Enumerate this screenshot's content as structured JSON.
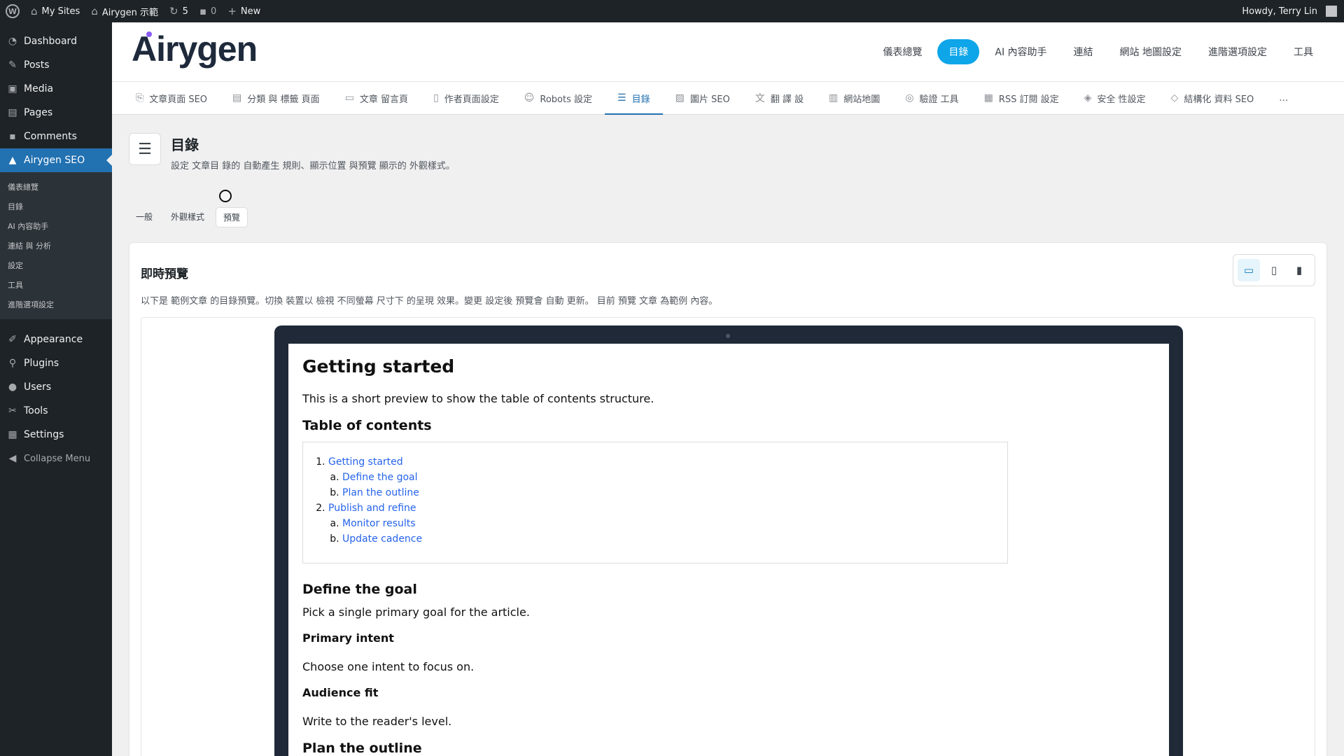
{
  "adminbar": {
    "my_sites": "My Sites",
    "site_name": "Airygen 示範",
    "updates_count": "5",
    "comments_count": "0",
    "new_label": "New",
    "howdy": "Howdy, Terry Lin"
  },
  "menu": {
    "items_top": [
      {
        "label": "Dashboard",
        "icon": "dashboard-icon"
      },
      {
        "label": "Posts",
        "icon": "pin-icon"
      },
      {
        "label": "Media",
        "icon": "media-icon"
      },
      {
        "label": "Pages",
        "icon": "pages-icon"
      },
      {
        "label": "Comments",
        "icon": "comments-icon"
      }
    ],
    "current": {
      "label": "Airygen SEO",
      "icon": "airygen-icon"
    },
    "sub": [
      "儀表總覽",
      "目錄",
      "AI 內容助手",
      "連結 與 分析",
      "設定",
      "工具",
      "進階選項設定"
    ],
    "items_bottom": [
      {
        "label": "Appearance",
        "icon": "brush-icon"
      },
      {
        "label": "Plugins",
        "icon": "plugin-icon"
      },
      {
        "label": "Users",
        "icon": "users-icon"
      },
      {
        "label": "Tools",
        "icon": "wrench-icon"
      },
      {
        "label": "Settings",
        "icon": "settings-icon"
      }
    ],
    "collapse": "Collapse Menu"
  },
  "header": {
    "logo": "irygen",
    "logo_a": "A",
    "nav": [
      "儀表總覽",
      "目錄",
      "AI 內容助手",
      "連結",
      "網站 地圖設定",
      "進階選項設定",
      "工具"
    ],
    "active_index": 1
  },
  "tabs": [
    {
      "label": "文章頁面 SEO",
      "icon": "copy-icon"
    },
    {
      "label": "分類 與 標籤 頁面",
      "icon": "newspaper-icon"
    },
    {
      "label": "文章 留言頁",
      "icon": "comment-icon"
    },
    {
      "label": "作者頁面設定",
      "icon": "file-icon"
    },
    {
      "label": "Robots 設定",
      "icon": "robot-icon"
    },
    {
      "label": "目錄",
      "icon": "list-icon",
      "active": true
    },
    {
      "label": "圖片 SEO",
      "icon": "image-icon"
    },
    {
      "label": "翻 譯 設",
      "icon": "translate-icon"
    },
    {
      "label": "網站地圖",
      "icon": "map-icon"
    },
    {
      "label": "驗證 工具",
      "icon": "check-circle-icon"
    },
    {
      "label": "RSS 訂閱 設定",
      "icon": "rss-icon"
    },
    {
      "label": "安全 性設定",
      "icon": "shield-icon"
    },
    {
      "label": "結構化 資料 SEO",
      "icon": "shield-check-icon"
    },
    {
      "label": "…",
      "icon": ""
    }
  ],
  "page": {
    "title": "目錄",
    "description": "設定 文章目 錄的 自動產生 規則、顯示位置 與預覽 顯示的 外觀樣式。"
  },
  "subtabs": [
    "一般",
    "外觀樣式",
    "預覽"
  ],
  "preview_card": {
    "title": "即時預覽",
    "description": "以下是 範例文章 的目錄預覽。切換 裝置以 檢視 不同螢幕 尺寸下 的呈現 效果。變更 設定後 預覽會 自動 更新。 目前 預覽 文章 為範例 內容。",
    "devices": [
      "laptop-icon",
      "tablet-icon",
      "phone-icon"
    ]
  },
  "article": {
    "h1": "Getting started",
    "intro": "This is a short preview to show the table of contents structure.",
    "toc_title": "Table of contents",
    "toc": [
      {
        "label": "Getting started",
        "children": [
          "Define the goal",
          "Plan the outline"
        ]
      },
      {
        "label": "Publish and refine",
        "children": [
          "Monitor results",
          "Update cadence"
        ]
      }
    ],
    "sec1_title": "Define the goal",
    "sec1_text": "Pick a single primary goal for the article.",
    "sub1_title": "Primary intent",
    "sub1_text": "Choose one intent to focus on.",
    "sub2_title": "Audience fit",
    "sub2_text": "Write to the reader's level.",
    "sec2_title": "Plan the outline"
  },
  "colors": {
    "accent": "#2271b1",
    "nav_active": "#0ea5e9",
    "admin_dark": "#1d2327"
  }
}
